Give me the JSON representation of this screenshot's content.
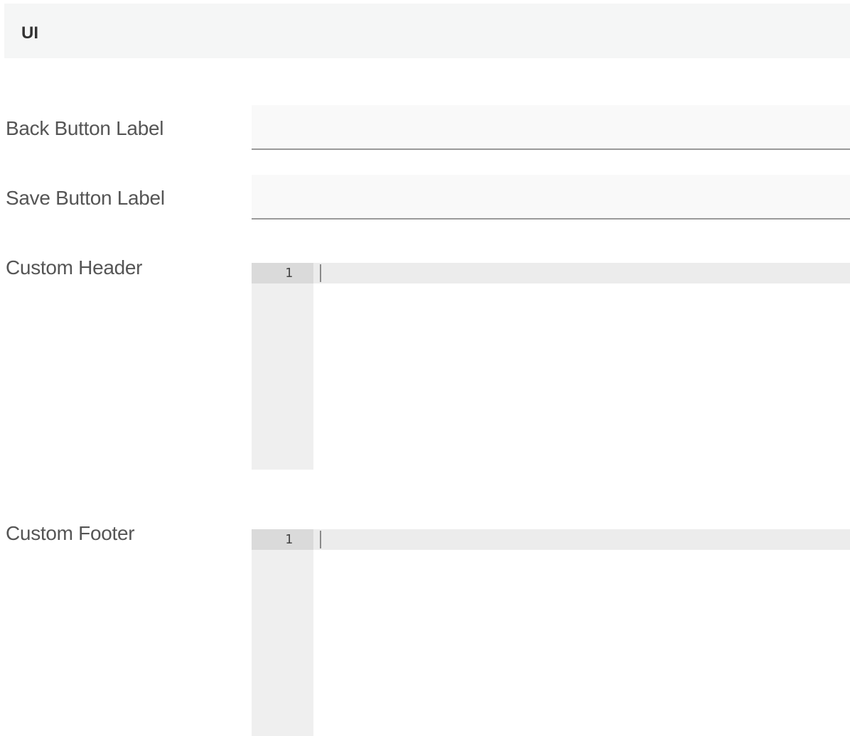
{
  "section": {
    "title": "UI"
  },
  "fields": {
    "back_button_label": {
      "label": "Back Button Label",
      "value": ""
    },
    "save_button_label": {
      "label": "Save Button Label",
      "value": ""
    },
    "custom_header": {
      "label": "Custom Header",
      "line_number": "1"
    },
    "custom_footer": {
      "label": "Custom Footer",
      "line_number": "1"
    }
  }
}
